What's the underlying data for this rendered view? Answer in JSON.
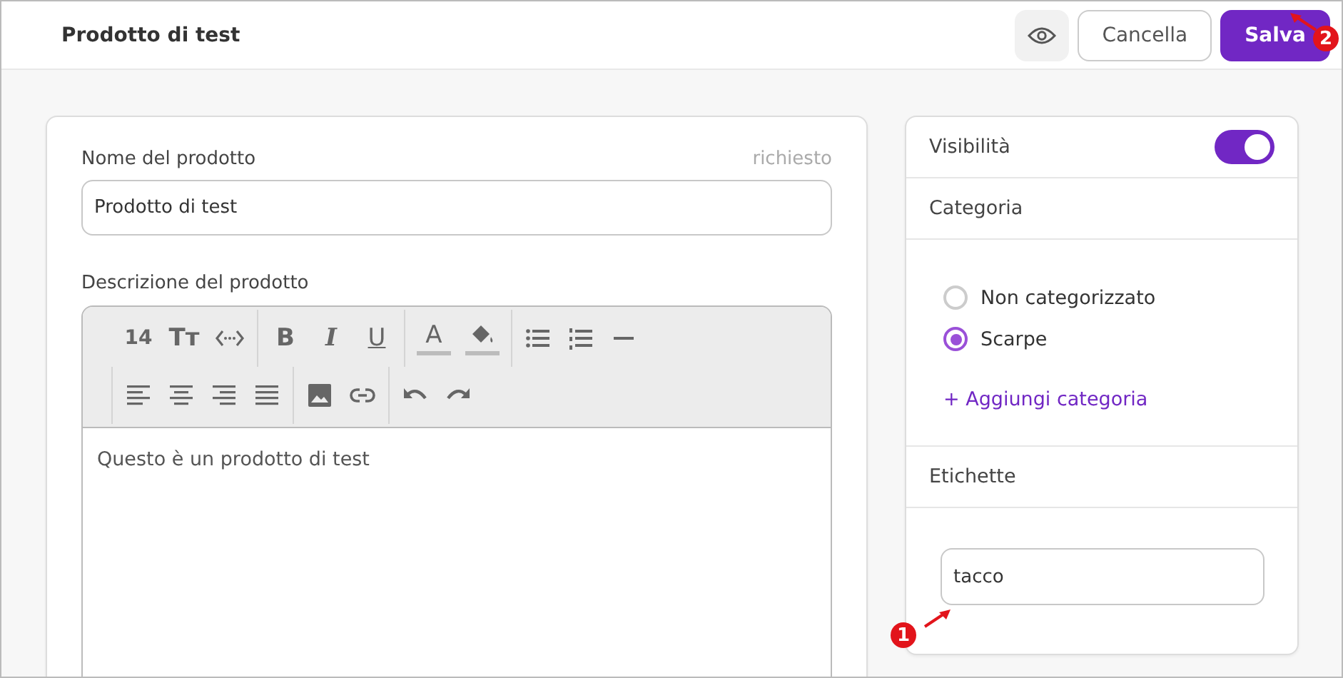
{
  "header": {
    "title": "Prodotto di test",
    "buttons": [
      {
        "kind": "preview"
      },
      {
        "kind": "secondary",
        "label": "Cancella"
      },
      {
        "kind": "primary",
        "label": "Salva"
      }
    ]
  },
  "product_name": {
    "label": "Nome del prodotto",
    "hint": "richiesto",
    "value": "Prodotto di test"
  },
  "description": {
    "label": "Descrizione del prodotto",
    "value": "Questo è un prodotto di test",
    "toolbar": [
      [
        [
          {
            "kind": "size",
            "label": "14"
          },
          {
            "kind": "heading",
            "label": "Tт"
          },
          {
            "kind": "code"
          }
        ],
        [
          {
            "kind": "bold",
            "label": "B"
          },
          {
            "kind": "italic",
            "label": "I"
          },
          {
            "kind": "underline",
            "label": "U"
          }
        ],
        [
          {
            "kind": "color",
            "label": "A"
          },
          {
            "kind": "bucket"
          }
        ],
        [
          {
            "kind": "bullets"
          },
          {
            "kind": "numbers"
          },
          {
            "kind": "rule"
          }
        ]
      ],
      [
        [
          {
            "kind": "align-left"
          },
          {
            "kind": "align-center"
          },
          {
            "kind": "align-right"
          },
          {
            "kind": "justify"
          }
        ],
        [
          {
            "kind": "image"
          },
          {
            "kind": "link"
          }
        ],
        [
          {
            "kind": "undo"
          },
          {
            "kind": "redo"
          }
        ]
      ]
    ]
  },
  "visibility": {
    "label": "Visibilità",
    "on": true
  },
  "category": {
    "title": "Categoria",
    "options": [
      {
        "label": "Non categorizzato",
        "selected": false
      },
      {
        "label": "Scarpe",
        "selected": true
      }
    ],
    "add_link": "+ Aggiungi categoria"
  },
  "tags": {
    "title": "Etichette",
    "value": "tacco"
  },
  "callouts": [
    {
      "number": "1"
    },
    {
      "number": "2"
    }
  ]
}
